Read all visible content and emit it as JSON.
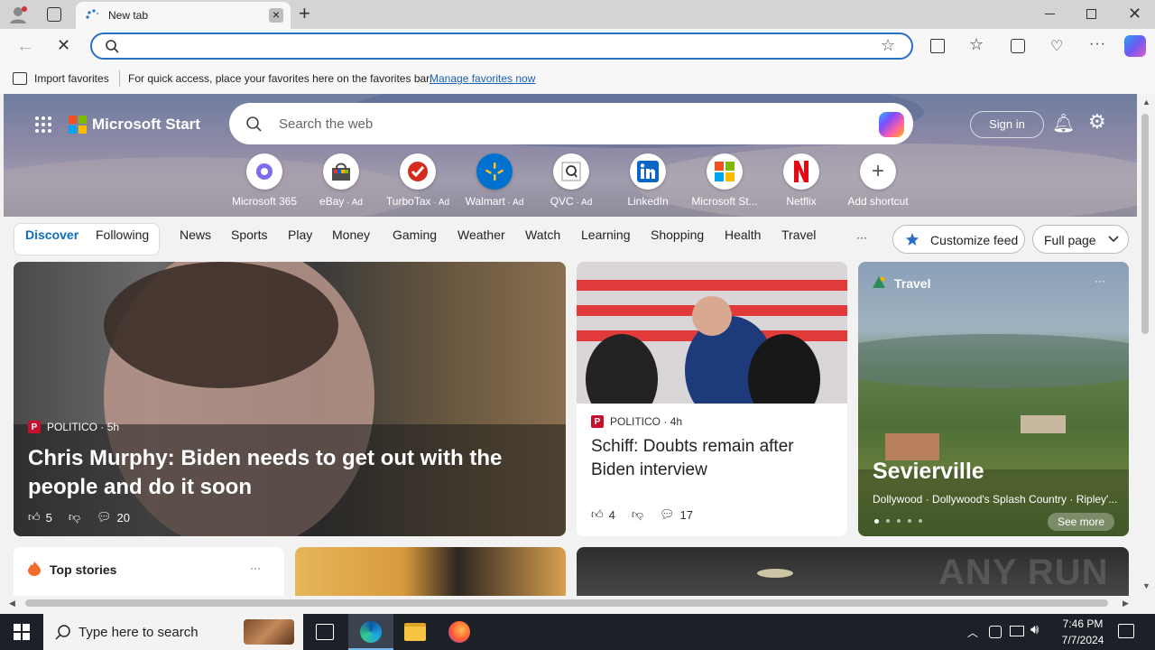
{
  "browser": {
    "tab_title": "New tab",
    "address_value": "",
    "favorites_bar": {
      "import_label": "Import favorites",
      "hint_text": "For quick access, place your favorites here on the favorites bar.",
      "manage_link": "Manage favorites now"
    }
  },
  "header": {
    "brand": "Microsoft Start",
    "search_placeholder": "Search the web",
    "sign_in": "Sign in"
  },
  "shortcuts": [
    {
      "label": "Microsoft 365",
      "ad": ""
    },
    {
      "label": "eBay",
      "ad": " · Ad"
    },
    {
      "label": "TurboTax",
      "ad": " · Ad"
    },
    {
      "label": "Walmart",
      "ad": " · Ad"
    },
    {
      "label": "QVC",
      "ad": " · Ad"
    },
    {
      "label": "LinkedIn",
      "ad": ""
    },
    {
      "label": "Microsoft St...",
      "ad": ""
    },
    {
      "label": "Netflix",
      "ad": ""
    },
    {
      "label": "Add shortcut",
      "ad": ""
    }
  ],
  "feed_nav": {
    "discover": "Discover",
    "following": "Following",
    "items": [
      "News",
      "Sports",
      "Play",
      "Money",
      "Gaming",
      "Weather",
      "Watch",
      "Learning",
      "Shopping",
      "Health",
      "Travel"
    ],
    "more": "···",
    "customize": "Customize feed",
    "layout": "Full page"
  },
  "cards": {
    "main": {
      "publisher": "POLITICO",
      "age": "· 5h",
      "headline": "Chris Murphy: Biden needs to get out with the people and do it soon",
      "likes": "5",
      "comments": "20"
    },
    "second": {
      "publisher": "POLITICO",
      "age": "· 4h",
      "headline": "Schiff: Doubts remain after Biden interview",
      "likes": "4",
      "comments": "17"
    },
    "travel": {
      "tag": "Travel",
      "title": "Sevierville",
      "subtitle": "Dollywood · Dollywood's Splash Country · Ripley'...",
      "see_more": "See more"
    },
    "top_stories": {
      "title": "Top stories"
    }
  },
  "watermark": "ANY RUN",
  "taskbar": {
    "search_placeholder": "Type here to search",
    "time": "7:46 PM",
    "date": "7/7/2024"
  },
  "colors": {
    "accent": "#0f6cbd",
    "politico": "#c8102e",
    "taskbar": "#1c2127"
  }
}
